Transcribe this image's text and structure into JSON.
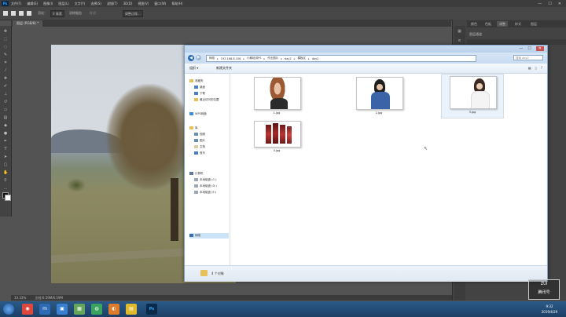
{
  "photoshop": {
    "logo": "Ps",
    "menu": [
      "文件(F)",
      "编辑(E)",
      "图像(I)",
      "图层(L)",
      "文字(Y)",
      "选择(S)",
      "滤镜(T)",
      "3D(D)",
      "视图(V)",
      "窗口(W)",
      "帮助(H)"
    ],
    "window_controls": [
      "—",
      "☐",
      "✕"
    ],
    "options": {
      "feather_label": "羽化：",
      "feather_value": "0 像素",
      "antialias": "消除锯齿",
      "style": "样式：",
      "refine": "调整边缘..."
    },
    "doc_tab": "图层 (RGB/8) *",
    "panel_tabs": [
      "颜色",
      "色板",
      "调整",
      "样式",
      "图层"
    ],
    "panel_row": "图层通道",
    "status_zoom": "33.33%",
    "status_doc": "文档:6.59M/6.59M"
  },
  "explorer": {
    "title": "",
    "window_controls": [
      "—",
      "☐",
      "✕"
    ],
    "nav_back_icon": "back-arrow-icon",
    "nav_forward_icon": "forward-arrow-icon",
    "breadcrumbs": [
      "网络",
      "192.168.8.106",
      "小鹅培训PS",
      "作业图片",
      "day2",
      "模板区",
      "day2"
    ],
    "search_placeholder": "搜索 day2",
    "cmd_organize": "组织 ▾",
    "cmd_share": "新建文件夹",
    "nav": {
      "favorites": "收藏夹",
      "fav_items": [
        "桌面",
        "下载",
        "最近访问的位置"
      ],
      "wps": "WPS网盘",
      "libraries": "库",
      "lib_items": [
        "视频",
        "图片",
        "文档",
        "音乐"
      ],
      "computer": "计算机",
      "comp_items": [
        "本地磁盘 (C:)",
        "本地磁盘 (D:)",
        "本地磁盘 (E:)"
      ],
      "network": "网络"
    },
    "files": [
      {
        "name": "1.jpg"
      },
      {
        "name": "2.jpg"
      },
      {
        "name": "3.jpg"
      },
      {
        "name": "4.jpg"
      }
    ],
    "status": "4 个对象"
  },
  "taskbar": {
    "clock_time": "9:32",
    "clock_date": "2019/4/29"
  },
  "watermark": {
    "line1": "ZUI",
    "line2": "腾讯号"
  }
}
